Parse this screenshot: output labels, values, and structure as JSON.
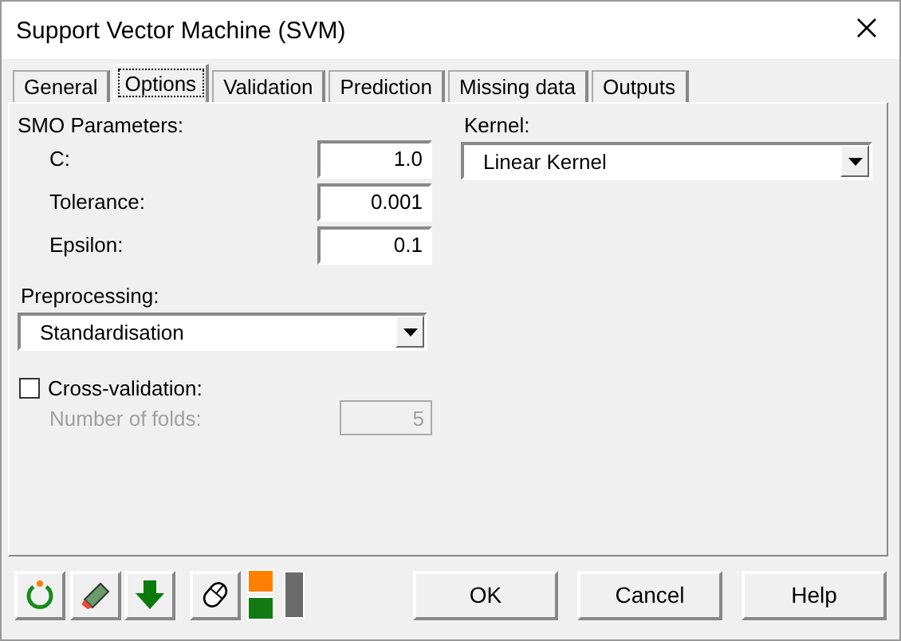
{
  "window": {
    "title": "Support Vector Machine (SVM)"
  },
  "tabs": [
    {
      "label": "General",
      "selected": false
    },
    {
      "label": "Options",
      "selected": true
    },
    {
      "label": "Validation",
      "selected": false
    },
    {
      "label": "Prediction",
      "selected": false
    },
    {
      "label": "Missing data",
      "selected": false
    },
    {
      "label": "Outputs",
      "selected": false
    }
  ],
  "smo_parameters": {
    "label": "SMO Parameters:",
    "params": [
      {
        "label": "C:",
        "value": "1.0"
      },
      {
        "label": "Tolerance:",
        "value": "0.001"
      },
      {
        "label": "Epsilon:",
        "value": "0.1"
      }
    ]
  },
  "preprocessing": {
    "label": "Preprocessing:",
    "value": "Standardisation"
  },
  "cross_validation": {
    "label": "Cross-validation:",
    "checked": false
  },
  "number_of_folds": {
    "label": "Number of folds:",
    "value": "5",
    "disabled": true
  },
  "kernel": {
    "label": "Kernel:",
    "value": "Linear Kernel"
  },
  "buttons": [
    "OK",
    "Cancel",
    "Help"
  ]
}
